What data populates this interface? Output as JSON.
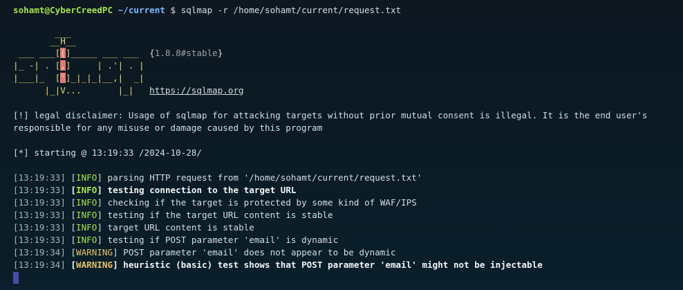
{
  "prompt": {
    "user_host": "sohamt@CyberCreedPC",
    "path": "~/current",
    "symbol": "$",
    "command": "sqlmap -r /home/sohamt/current/request.txt"
  },
  "banner": {
    "logo_lines": [
      "        ___",
      "       __H__",
      " ___ ___[(]_____ ___ ___  ",
      "|_ -| . [,]     | .'| . |",
      "|___|_  [']_|_|_|__,|  _|",
      "      |_|V...       |_|   "
    ],
    "version": "1.8.8#stable",
    "url": "https://sqlmap.org"
  },
  "disclaimer": {
    "line1": "[!] legal disclaimer: Usage of sqlmap for attacking targets without prior mutual consent is illegal. It is the end user's",
    "line2": "responsible for any misuse or damage caused by this program"
  },
  "starting": "[*] starting @ 13:19:33 /2024-10-28/",
  "log": [
    {
      "ts": "[13:19:33]",
      "level": "INFO",
      "msg": "parsing HTTP request from '/home/sohamt/current/request.txt'",
      "bold": false
    },
    {
      "ts": "[13:19:33]",
      "level": "INFO",
      "msg": "testing connection to the target URL",
      "bold": true
    },
    {
      "ts": "[13:19:33]",
      "level": "INFO",
      "msg": "checking if the target is protected by some kind of WAF/IPS",
      "bold": false
    },
    {
      "ts": "[13:19:33]",
      "level": "INFO",
      "msg": "testing if the target URL content is stable",
      "bold": false
    },
    {
      "ts": "[13:19:33]",
      "level": "INFO",
      "msg": "target URL content is stable",
      "bold": false
    },
    {
      "ts": "[13:19:33]",
      "level": "INFO",
      "msg": "testing if POST parameter 'email' is dynamic",
      "bold": false
    },
    {
      "ts": "[13:19:34]",
      "level": "WARNING",
      "msg": "POST parameter 'email' does not appear to be dynamic",
      "bold": false
    },
    {
      "ts": "[13:19:34]",
      "level": "WARNING",
      "msg": "heuristic (basic) test shows that POST parameter 'email' might not be injectable",
      "bold": true
    }
  ],
  "colors": {
    "background": "#0b1a24",
    "info": "#a6e24a",
    "warning": "#e5c16a",
    "path": "#7ab7ff",
    "logo": "#e8d678",
    "logo_highlight": "#e07a77",
    "cursor": "#4a4aa8"
  }
}
